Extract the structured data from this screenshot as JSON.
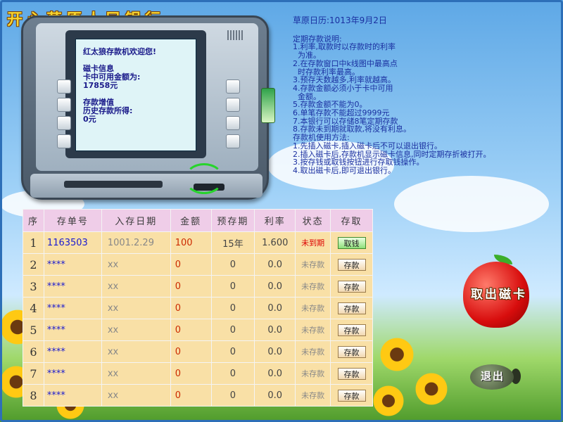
{
  "app": {
    "title": "开心草原人民银行",
    "date": "草原日历:1013年9月2日"
  },
  "atm": {
    "welcome": "红太狼存款机欢迎您!",
    "card_info_title": "磁卡信息",
    "card_balance_label": "卡中可用金额为:",
    "card_balance_value": "17858元",
    "interest_title": "存款增值",
    "interest_label": "历史存款所得:",
    "interest_value": "0元"
  },
  "instructions": {
    "heading": "定期存款说明:",
    "lines": [
      "1.利率,取款时以存款时的利率",
      "  为准。",
      "2.在存款窗口中k线图中最高点",
      "  时存款利率最高。",
      "3.预存天数越多,利率就越高。",
      "4.存款金额必须小于卡中可用",
      "  金额。",
      "5.存款金额不能为0。",
      "6.单笔存款不能超过9999元",
      "7.本银行可以存储8笔定期存款",
      "8.存款未到期就取款,将没有利息。",
      "存款机使用方法:",
      "1.先插入磁卡,插入磁卡后不可以退出银行。",
      "2.插入磁卡后,存款机显示磁卡信息,同时定期存折被打开。",
      "3.按存钱或取钱按钮进行存取钱操作。",
      "4.取出磁卡后,即可退出银行。"
    ]
  },
  "table": {
    "headers": [
      "序",
      "存单号",
      "入存日期",
      "金额",
      "预存期",
      "利率",
      "状态",
      "存取"
    ],
    "rows": [
      {
        "seq": "1",
        "id": "1163503",
        "date": "1001.2.29",
        "amount": "100",
        "term": "15年",
        "rate": "1.600",
        "status": "未到期",
        "action": "取钱"
      },
      {
        "seq": "2",
        "id": "****",
        "date": "xx",
        "amount": "0",
        "term": "0",
        "rate": "0.0",
        "status": "未存款",
        "action": "存款"
      },
      {
        "seq": "3",
        "id": "****",
        "date": "xx",
        "amount": "0",
        "term": "0",
        "rate": "0.0",
        "status": "未存款",
        "action": "存款"
      },
      {
        "seq": "4",
        "id": "****",
        "date": "xx",
        "amount": "0",
        "term": "0",
        "rate": "0.0",
        "status": "未存款",
        "action": "存款"
      },
      {
        "seq": "5",
        "id": "****",
        "date": "xx",
        "amount": "0",
        "term": "0",
        "rate": "0.0",
        "status": "未存款",
        "action": "存款"
      },
      {
        "seq": "6",
        "id": "****",
        "date": "xx",
        "amount": "0",
        "term": "0",
        "rate": "0.0",
        "status": "未存款",
        "action": "存款"
      },
      {
        "seq": "7",
        "id": "****",
        "date": "xx",
        "amount": "0",
        "term": "0",
        "rate": "0.0",
        "status": "未存款",
        "action": "存款"
      },
      {
        "seq": "8",
        "id": "****",
        "date": "xx",
        "amount": "0",
        "term": "0",
        "rate": "0.0",
        "status": "未存款",
        "action": "存款"
      }
    ]
  },
  "buttons": {
    "eject_card": "取出磁卡",
    "exit": "退出"
  },
  "colors": {
    "title_yellow": "#f6d530",
    "instruction_blue": "#1a2fa0",
    "table_header_pink": "#efcde8",
    "table_row_tan": "#f9e0a6",
    "status_due_red": "#dd0000"
  }
}
